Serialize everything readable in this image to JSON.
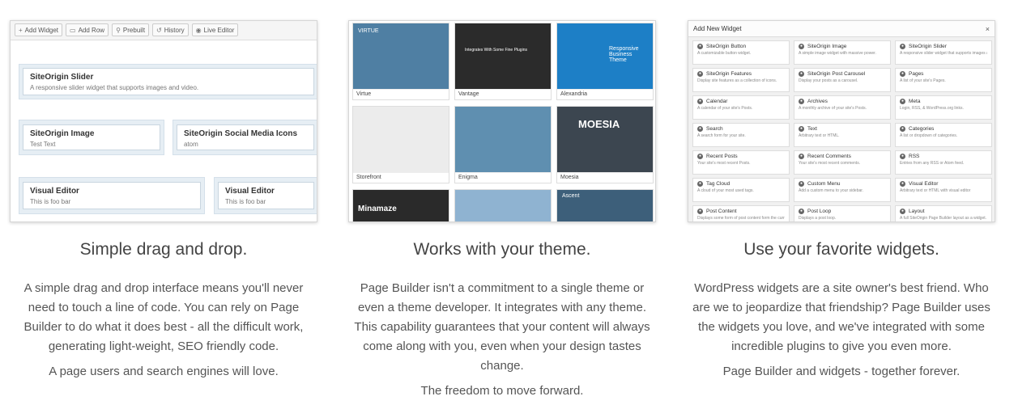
{
  "features": [
    {
      "title": "Simple drag and drop.",
      "paragraphs": [
        "A simple drag and drop interface means you'll never need to touch a line of code. You can rely on Page Builder to do what it does best - all the difficult work, generating light-weight, SEO friendly code.",
        "A page users and search engines will love."
      ]
    },
    {
      "title": "Works with your theme.",
      "paragraphs": [
        "Page Builder isn't a commitment to a single theme or even a theme developer. It integrates with any theme. This capability guarantees that your content will always come along with you, even when your design tastes change.",
        "The freedom to move forward."
      ]
    },
    {
      "title": "Use your favorite widgets.",
      "paragraphs": [
        "WordPress widgets are a site owner's best friend. Who are we to jeopardize that friendship? Page Builder uses the widgets you love, and we've integrated with some incredible plugins to give you even more.",
        "Page Builder and widgets - together forever."
      ]
    }
  ],
  "builder": {
    "toolbar": [
      {
        "label": "Add Widget",
        "icon": "+"
      },
      {
        "label": "Add Row",
        "icon": "▭"
      },
      {
        "label": "Prebuilt",
        "icon": "⚲"
      },
      {
        "label": "History",
        "icon": "↺"
      },
      {
        "label": "Live Editor",
        "icon": "◉"
      }
    ],
    "widgets": [
      {
        "title": "SiteOrigin Slider",
        "desc": "A responsive slider widget that supports images and video."
      },
      {
        "title": "SiteOrigin Image",
        "desc": "Test Text"
      },
      {
        "title": "SiteOrigin Social Media Icons",
        "desc": "atom"
      },
      {
        "title": "Visual Editor",
        "desc": "This is foo bar"
      },
      {
        "title": "Visual Editor",
        "desc": "This is foo bar"
      }
    ]
  },
  "themes": [
    {
      "name": "Virtue",
      "color": "#4f7fa3",
      "overlay": "VIRTUE"
    },
    {
      "name": "Vantage",
      "color": "#2b2b2b",
      "overlay": "Integrates With Some Fine Plugins"
    },
    {
      "name": "Alexandria",
      "color": "#1d7fc6",
      "overlay": "Responsive Business Theme"
    },
    {
      "name": "Storefront",
      "color": "#ececec",
      "overlay": ""
    },
    {
      "name": "Enigma",
      "color": "#5f8fb0",
      "overlay": ""
    },
    {
      "name": "Moesia",
      "color": "#3c4650",
      "overlay": "MOESIA"
    },
    {
      "name": "",
      "color": "#2a2a2a",
      "overlay": "Minamaze"
    },
    {
      "name": "",
      "color": "#8fb3d1",
      "overlay": ""
    },
    {
      "name": "",
      "color": "#3d5f7a",
      "overlay": "Ascent"
    }
  ],
  "widgets_dialog": {
    "title": "Add New Widget",
    "close": "×",
    "items": [
      {
        "name": "SiteOrigin Button",
        "desc": "A customizable button widget."
      },
      {
        "name": "SiteOrigin Image",
        "desc": "A simple image widget with massive power."
      },
      {
        "name": "SiteOrigin Slider",
        "desc": "A responsive slider widget that supports images and video."
      },
      {
        "name": "SiteOrigin Features",
        "desc": "Display site features as a collection of icons."
      },
      {
        "name": "SiteOrigin Post Carousel",
        "desc": "Display your posts as a carousel."
      },
      {
        "name": "Pages",
        "desc": "A list of your site's Pages."
      },
      {
        "name": "Calendar",
        "desc": "A calendar of your site's Posts."
      },
      {
        "name": "Archives",
        "desc": "A monthly archive of your site's Posts."
      },
      {
        "name": "Meta",
        "desc": "Login, RSS, & WordPress.org links."
      },
      {
        "name": "Search",
        "desc": "A search form for your site."
      },
      {
        "name": "Text",
        "desc": "Arbitrary text or HTML."
      },
      {
        "name": "Categories",
        "desc": "A list or dropdown of categories."
      },
      {
        "name": "Recent Posts",
        "desc": "Your site's most recent Posts."
      },
      {
        "name": "Recent Comments",
        "desc": "Your site's most recent comments."
      },
      {
        "name": "RSS",
        "desc": "Entries from any RSS or Atom feed."
      },
      {
        "name": "Tag Cloud",
        "desc": "A cloud of your most used tags."
      },
      {
        "name": "Custom Menu",
        "desc": "Add a custom menu to your sidebar."
      },
      {
        "name": "Visual Editor",
        "desc": "Arbitrary text or HTML with visual editor"
      },
      {
        "name": "Post Content",
        "desc": "Displays some form of post content form the current post."
      },
      {
        "name": "Post Loop",
        "desc": "Displays a post loop."
      },
      {
        "name": "Layout",
        "desc": "A full SiteOrigin Page Builder layout as a widget."
      }
    ]
  }
}
